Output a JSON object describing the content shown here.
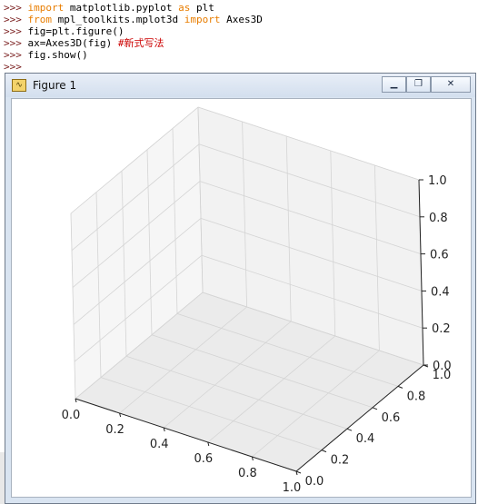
{
  "console": {
    "prompt": ">>>",
    "lines": [
      {
        "k1": "import",
        "t1": " matplotlib.pyplot ",
        "k2": "as",
        "t2": " plt",
        "cm": ""
      },
      {
        "k1": "from",
        "t1": " mpl_toolkits.mplot3d ",
        "k2": "import",
        "t2": " Axes3D",
        "cm": ""
      },
      {
        "k1": "",
        "t1": "fig=plt.figure()",
        "k2": "",
        "t2": "",
        "cm": ""
      },
      {
        "k1": "",
        "t1": "ax=Axes3D(fig) ",
        "k2": "",
        "t2": "",
        "cm": "#新式写法"
      },
      {
        "k1": "",
        "t1": "fig.show()",
        "k2": "",
        "t2": "",
        "cm": ""
      }
    ]
  },
  "window": {
    "title": "Figure 1",
    "icon": "matplotlib-figure-icon",
    "buttons": {
      "minimize_icon": "minimize-icon",
      "restore_icon": "restore-icon",
      "close_icon": "close-icon"
    }
  },
  "chart_data": {
    "type": "scatter",
    "projection": "3d",
    "x": [],
    "y": [],
    "z": [],
    "xlim": [
      0,
      1
    ],
    "ylim": [
      0,
      1
    ],
    "zlim": [
      0,
      1
    ],
    "x_ticks": [
      "0.0",
      "0.2",
      "0.4",
      "0.6",
      "0.8",
      "1.0"
    ],
    "y_ticks": [
      "0.0",
      "0.2",
      "0.4",
      "0.6",
      "0.8",
      "1.0"
    ],
    "z_ticks": [
      "0.0",
      "0.2",
      "0.4",
      "0.6",
      "0.8",
      "1.0"
    ],
    "grid": true,
    "title": "",
    "xlabel": "",
    "ylabel": "",
    "zlabel": ""
  }
}
